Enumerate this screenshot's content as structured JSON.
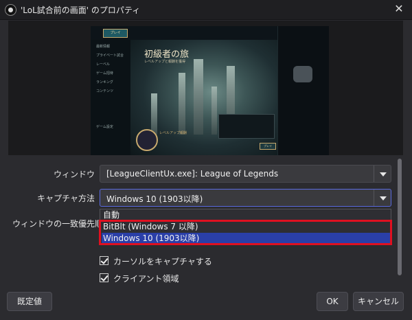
{
  "window": {
    "title": "'LoL試合前の画面' のプロパティ",
    "close_glyph": "✕"
  },
  "preview": {
    "game_play_label": "プレイ",
    "heading": "初級者の旅",
    "subheading": "レベルアップと報酬を獲得",
    "nav_items": [
      "最新情報",
      "プライベート試合",
      "レーベル",
      "ゲーム招待",
      "ランキング",
      "コンテンツ",
      "",
      "",
      "",
      "ゲーム設定"
    ],
    "level_up_label": "レベルアップ報酬",
    "play2_label": "プレイ"
  },
  "form": {
    "window_label": "ウィンドウ",
    "window_value": "[LeagueClientUx.exe]: League of Legends",
    "capture_method_label": "キャプチャ方法",
    "capture_method_value": "Windows 10 (1903以降)",
    "window_priority_label": "ウィンドウの一致優先順位",
    "dropdown_options": [
      {
        "label": "自動",
        "selected": false
      },
      {
        "label": "BitBlt (Windows 7 以降)",
        "selected": false
      },
      {
        "label": "Windows 10 (1903以降)",
        "selected": true
      }
    ],
    "capture_cursor_label": "カーソルをキャプチャする",
    "capture_cursor_checked": true,
    "client_area_label": "クライアント領域",
    "client_area_checked": true
  },
  "buttons": {
    "defaults": "既定値",
    "ok": "OK",
    "cancel": "キャンセル"
  },
  "colors": {
    "background": "#2b2b2f",
    "selection": "#2a3fa8",
    "highlight": "#e01020",
    "focus_border": "#5a6ae0"
  }
}
